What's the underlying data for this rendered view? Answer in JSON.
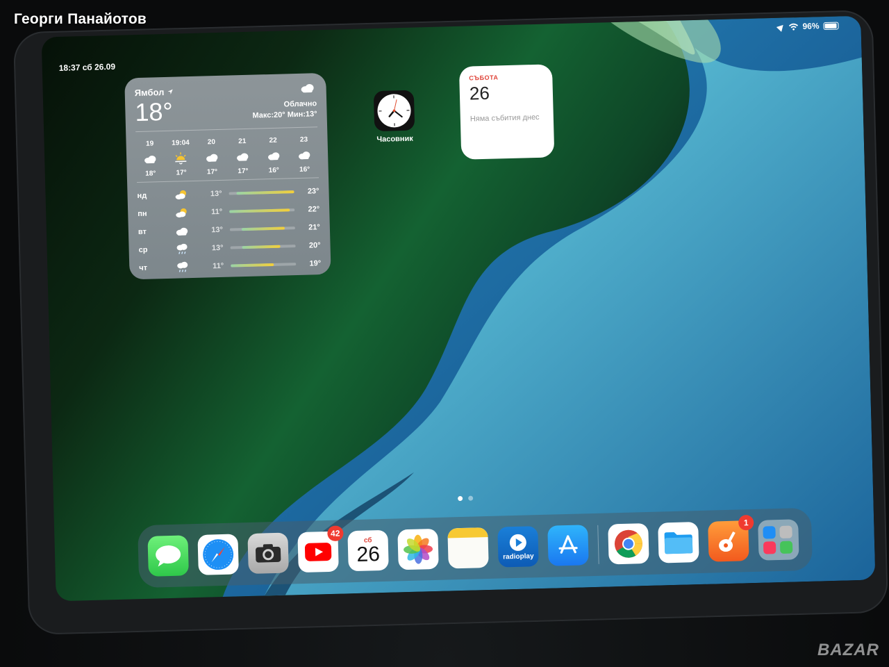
{
  "photo": {
    "uploader": "Георги Панайотов",
    "watermark": "BAZAR"
  },
  "status_bar": {
    "time_date": "18:37  сб 26.09",
    "battery_pct": "96%",
    "icons": [
      "location-arrow-icon",
      "wifi-icon",
      "battery-icon"
    ]
  },
  "weather_widget": {
    "city": "Ямбол",
    "temp": "18°",
    "condition": "Облачно",
    "hilo": "Макс:20° Мин:13°",
    "hourly": [
      {
        "time": "19",
        "icon": "cloud-icon",
        "temp": "18°"
      },
      {
        "time": "19:04",
        "icon": "sunset-icon",
        "temp": "17°"
      },
      {
        "time": "20",
        "icon": "cloud-icon",
        "temp": "17°"
      },
      {
        "time": "21",
        "icon": "cloud-icon",
        "temp": "17°"
      },
      {
        "time": "22",
        "icon": "cloud-icon",
        "temp": "16°"
      },
      {
        "time": "23",
        "icon": "cloud-icon",
        "temp": "16°"
      }
    ],
    "daily": [
      {
        "day": "нд",
        "icon": "partly-sunny-icon",
        "low": "13°",
        "high": "23°",
        "range": [
          0.12,
          1.0
        ]
      },
      {
        "day": "пн",
        "icon": "partly-sunny-icon",
        "low": "11°",
        "high": "22°",
        "range": [
          0.0,
          0.92
        ]
      },
      {
        "day": "вт",
        "icon": "cloud-icon",
        "low": "13°",
        "high": "21°",
        "range": [
          0.18,
          0.84
        ]
      },
      {
        "day": "ср",
        "icon": "rain-icon",
        "low": "13°",
        "high": "20°",
        "range": [
          0.18,
          0.76
        ]
      },
      {
        "day": "чт",
        "icon": "rain-icon",
        "low": "11°",
        "high": "19°",
        "range": [
          0.0,
          0.66
        ]
      }
    ]
  },
  "clock_app": {
    "label": "Часовник"
  },
  "calendar_widget": {
    "weekday": "СЪБОТА",
    "day": "26",
    "empty": "Няма събития днес"
  },
  "dock": {
    "youtube_badge": "42",
    "calendar_weekday": "сб",
    "calendar_day": "26",
    "radioplay_label": "radioplay",
    "garageband_badge": "1"
  }
}
